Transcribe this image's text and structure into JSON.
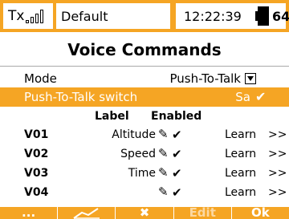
{
  "status": {
    "tx_label": "Tx",
    "model_name": "Default",
    "clock": "12:22:39",
    "battery": "64%",
    "accent_color": "#f5a524"
  },
  "page": {
    "title": "Voice Commands"
  },
  "settings": {
    "mode_label": "Mode",
    "mode_value": "Push-To-Talk",
    "ptt_label": "Push-To-Talk switch",
    "ptt_value": "Sa",
    "ptt_check": "✔"
  },
  "table": {
    "col_label": "Label",
    "col_enabled": "Enabled",
    "rows": [
      {
        "id": "V01",
        "name": "Altitude",
        "enabled": "✔",
        "learn": "Learn",
        "more": ">>"
      },
      {
        "id": "V02",
        "name": "Speed",
        "enabled": "✔",
        "learn": "Learn",
        "more": ">>"
      },
      {
        "id": "V03",
        "name": "Time",
        "enabled": "✔",
        "learn": "Learn",
        "more": ">>"
      },
      {
        "id": "V04",
        "name": "",
        "enabled": "✔",
        "learn": "Learn",
        "more": ">>"
      }
    ]
  },
  "footer": {
    "btn1": "...",
    "btn4": "Edit",
    "btn5": "Ok"
  }
}
